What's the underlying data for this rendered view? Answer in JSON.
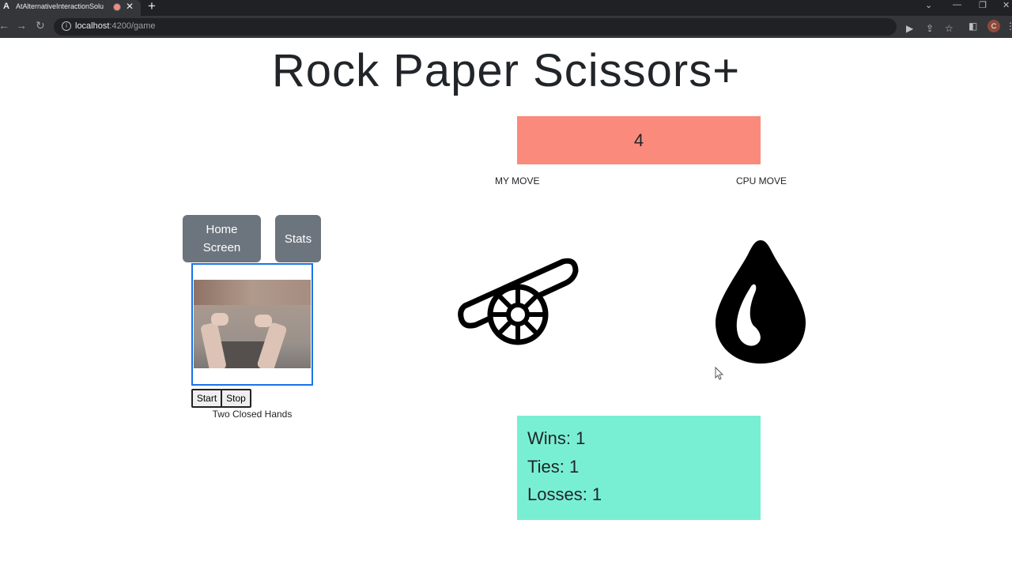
{
  "browser": {
    "tab_logo": "A",
    "tab_title": "AtAlternativeInteractionSolu",
    "tab_close": "✕",
    "new_tab": "+",
    "url_host": "localhost",
    "url_path": ":4200/game",
    "profile_initial": "C"
  },
  "page": {
    "title": "Rock Paper Scissors+",
    "countdown": "4",
    "countdown_color": "#fa8b7c"
  },
  "labels": {
    "my_move": "MY MOVE",
    "cpu_move": "CPU MOVE"
  },
  "nav": {
    "home_line1": "Home",
    "home_line2": "Screen",
    "stats": "Stats"
  },
  "camera": {
    "start": "Start",
    "stop": "Stop",
    "gesture": "Two Closed Hands"
  },
  "moves": {
    "my_icon": "cannon-icon",
    "cpu_icon": "water-drop-icon"
  },
  "stats": {
    "wins": "Wins: 1",
    "ties": "Ties: 1",
    "losses": "Losses: 1",
    "box_color": "#78efd3"
  }
}
